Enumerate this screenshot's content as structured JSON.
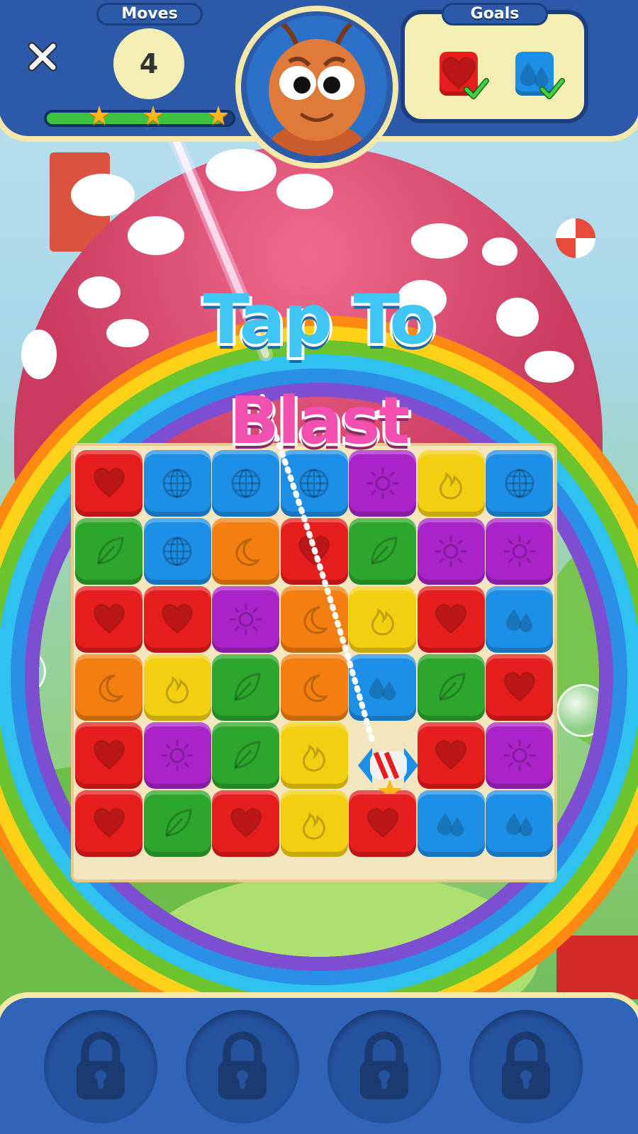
{
  "hud": {
    "moves_label": "Moves",
    "moves_value": "4",
    "goals_label": "Goals",
    "progress_fraction": 0.95,
    "stars_earned": 3,
    "goals": [
      {
        "icon": "red-heart-tile-icon",
        "color": "#e51d1d",
        "completed": true
      },
      {
        "icon": "blue-drop-tile-icon",
        "color": "#1e8fe6",
        "completed": true
      }
    ]
  },
  "overlay": {
    "line1": "Tap To",
    "line2": "Blast"
  },
  "board": {
    "columns": 7,
    "rows": 6,
    "tiles": [
      [
        "red-heart",
        "blue-globe",
        "blue-globe",
        "blue-globe",
        "purple-sun",
        "yellow-fire",
        "blue-globe"
      ],
      [
        "green-leaf",
        "blue-globe",
        "orange-moon",
        "red-heart",
        "green-leaf",
        "purple-sun",
        "purple-sun"
      ],
      [
        "red-heart",
        "red-heart",
        "purple-sun",
        "orange-moon",
        "yellow-fire",
        "red-heart",
        "blue-drop"
      ],
      [
        "orange-moon",
        "yellow-fire",
        "green-leaf",
        "orange-moon",
        "blue-drop",
        "green-leaf",
        "red-heart"
      ],
      [
        "red-heart",
        "purple-sun",
        "green-leaf",
        "yellow-fire",
        "rocket",
        "red-heart",
        "purple-sun"
      ],
      [
        "red-heart",
        "green-leaf",
        "red-heart",
        "yellow-fire",
        "red-heart",
        "blue-drop",
        "blue-drop"
      ]
    ]
  },
  "boosters": [
    {
      "name": "booster-slot-1",
      "locked": true
    },
    {
      "name": "booster-slot-2",
      "locked": true
    },
    {
      "name": "booster-slot-3",
      "locked": true
    },
    {
      "name": "booster-slot-4",
      "locked": true
    }
  ]
}
